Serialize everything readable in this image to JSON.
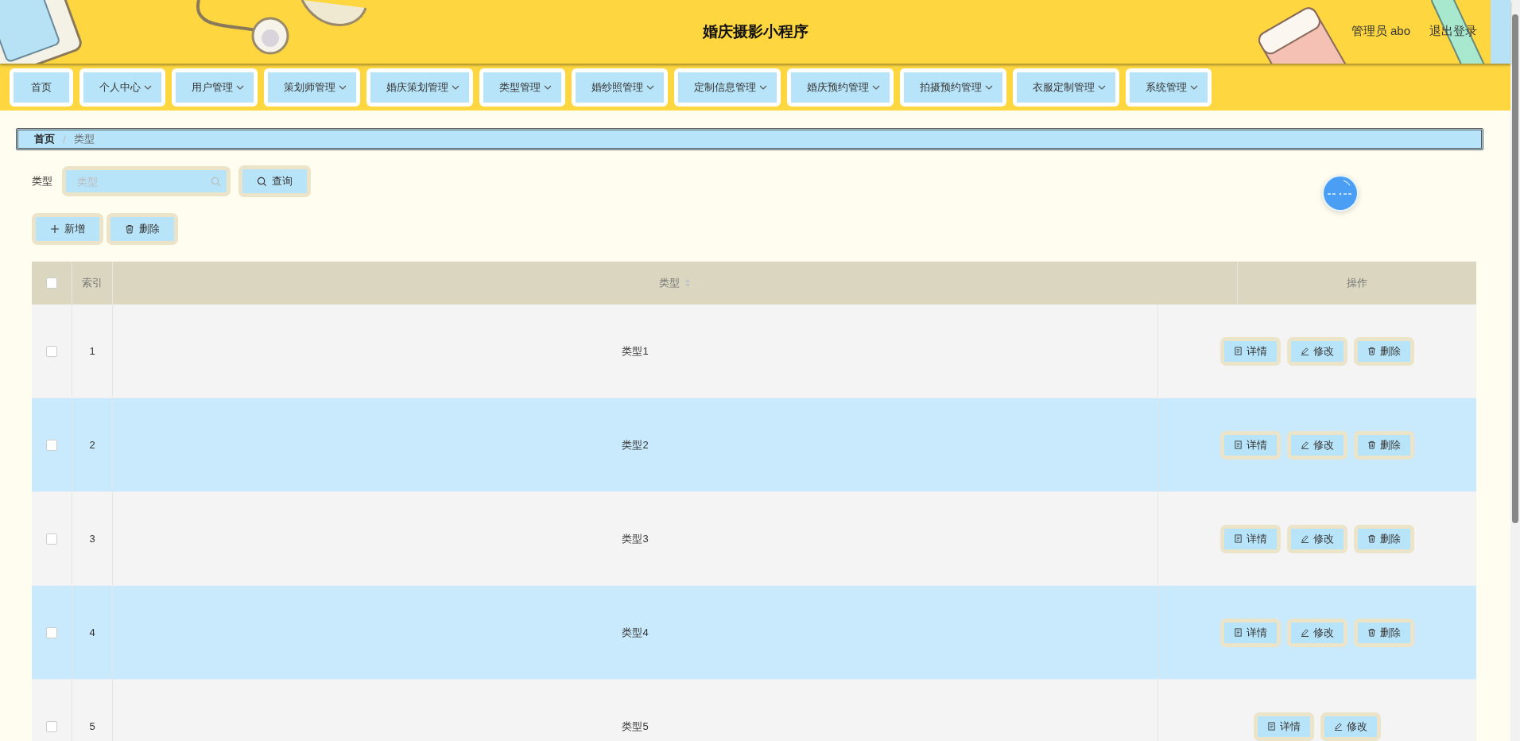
{
  "header": {
    "title": "婚庆摄影小程序",
    "user": "管理员 abo",
    "logout": "退出登录"
  },
  "nav": [
    {
      "label": "首页",
      "dropdown": false
    },
    {
      "label": "个人中心",
      "dropdown": true
    },
    {
      "label": "用户管理",
      "dropdown": true
    },
    {
      "label": "策划师管理",
      "dropdown": true
    },
    {
      "label": "婚庆策划管理",
      "dropdown": true
    },
    {
      "label": "类型管理",
      "dropdown": true
    },
    {
      "label": "婚纱照管理",
      "dropdown": true
    },
    {
      "label": "定制信息管理",
      "dropdown": true
    },
    {
      "label": "婚庆预约管理",
      "dropdown": true
    },
    {
      "label": "拍摄预约管理",
      "dropdown": true
    },
    {
      "label": "衣服定制管理",
      "dropdown": true
    },
    {
      "label": "系统管理",
      "dropdown": true
    }
  ],
  "breadcrumb": {
    "separator": "/",
    "items": [
      {
        "label": "首页",
        "current": false
      },
      {
        "label": "类型",
        "current": true
      }
    ]
  },
  "search": {
    "label": "类型",
    "placeholder": "类型",
    "button": "查询"
  },
  "actions": [
    {
      "kind": "add",
      "label": "新增"
    },
    {
      "kind": "delete",
      "label": "删除"
    }
  ],
  "table": {
    "select_all": {
      "checked": false
    },
    "columns": [
      {
        "label": "索引",
        "sortable": false
      },
      {
        "label": "类型",
        "sortable": true
      },
      {
        "label": "操作",
        "sortable": false
      }
    ],
    "rows": [
      {
        "checked": false,
        "index": "1",
        "type": "类型1",
        "buttons": [
          {
            "kind": "detail",
            "label": "详情"
          },
          {
            "kind": "edit",
            "label": "修改"
          },
          {
            "kind": "delete",
            "label": "删除"
          }
        ]
      },
      {
        "checked": false,
        "index": "2",
        "type": "类型2",
        "buttons": [
          {
            "kind": "detail",
            "label": "详情"
          },
          {
            "kind": "edit",
            "label": "修改"
          },
          {
            "kind": "delete",
            "label": "删除"
          }
        ]
      },
      {
        "checked": false,
        "index": "3",
        "type": "类型3",
        "buttons": [
          {
            "kind": "detail",
            "label": "详情"
          },
          {
            "kind": "edit",
            "label": "修改"
          },
          {
            "kind": "delete",
            "label": "删除"
          }
        ]
      },
      {
        "checked": false,
        "index": "4",
        "type": "类型4",
        "buttons": [
          {
            "kind": "detail",
            "label": "详情"
          },
          {
            "kind": "edit",
            "label": "修改"
          },
          {
            "kind": "delete",
            "label": "删除"
          }
        ]
      },
      {
        "checked": false,
        "index": "5",
        "type": "类型5",
        "buttons": [
          {
            "kind": "detail",
            "label": "详情"
          },
          {
            "kind": "edit",
            "label": "修改"
          }
        ]
      }
    ]
  }
}
